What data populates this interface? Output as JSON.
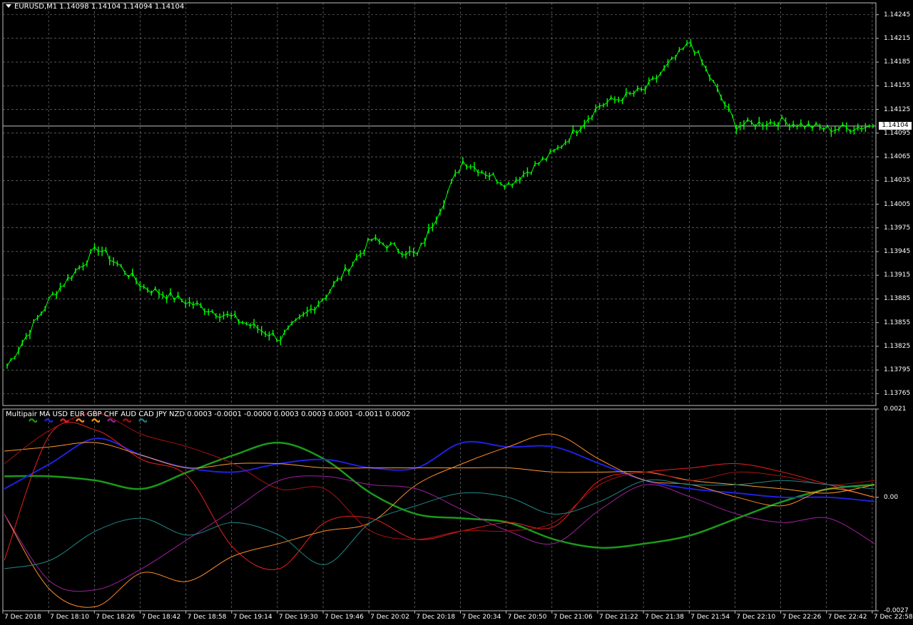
{
  "window": {
    "symbol_header": "EURUSD,M1  1.14098 1.14104 1.14094 1.14104"
  },
  "main_chart": {
    "current_price_label": "1.14104",
    "y_ticks": [
      "1.14245",
      "1.14215",
      "1.14185",
      "1.14155",
      "1.14125",
      "1.14095",
      "1.14065",
      "1.14035",
      "1.14005",
      "1.13975",
      "1.13945",
      "1.13915",
      "1.13885",
      "1.13855",
      "1.13825",
      "1.13795",
      "1.13765"
    ]
  },
  "indicator": {
    "header": "Multipair MA  USD EUR GBP CHF AUD CAD JPY NZD 0.0003 -0.0001 -0.0000 0.0003 0.0003 0.0001 -0.0011 0.0002",
    "y_ticks": [
      "0.0021",
      "0.00",
      "-0.0027"
    ],
    "legend_colors": [
      "#1a9a1a",
      "#2222ee",
      "#ee2222",
      "#ff8c2a",
      "#ff9900",
      "#a020a0",
      "#aa1111",
      "#208080"
    ]
  },
  "x_axis": {
    "labels": [
      "7 Dec 2018",
      "7 Dec 18:10",
      "7 Dec 18:26",
      "7 Dec 18:42",
      "7 Dec 18:58",
      "7 Dec 19:14",
      "7 Dec 19:30",
      "7 Dec 19:46",
      "7 Dec 20:02",
      "7 Dec 20:18",
      "7 Dec 20:34",
      "7 Dec 20:50",
      "7 Dec 21:06",
      "7 Dec 21:22",
      "7 Dec 21:38",
      "7 Dec 21:54",
      "7 Dec 22:10",
      "7 Dec 22:26",
      "7 Dec 22:42",
      "7 Dec 22:58"
    ]
  },
  "chart_data": [
    {
      "type": "line",
      "title": "EURUSD,M1",
      "series": [
        {
          "name": "EURUSD",
          "color": "#00ff00",
          "x": [
            "7 Dec 2018",
            "7 Dec 18:10",
            "7 Dec 18:26",
            "7 Dec 18:42",
            "7 Dec 18:58",
            "7 Dec 19:14",
            "7 Dec 19:30",
            "7 Dec 19:46",
            "7 Dec 20:02",
            "7 Dec 20:18",
            "7 Dec 20:34",
            "7 Dec 20:50",
            "7 Dec 21:06",
            "7 Dec 21:22",
            "7 Dec 21:38",
            "7 Dec 21:54",
            "7 Dec 22:10",
            "7 Dec 22:26",
            "7 Dec 22:42",
            "7 Dec 22:58"
          ],
          "values": [
            1.138,
            1.1389,
            1.1395,
            1.139,
            1.1388,
            1.1386,
            1.13835,
            1.1389,
            1.1396,
            1.1394,
            1.1406,
            1.1403,
            1.1407,
            1.1413,
            1.1415,
            1.1421,
            1.14105,
            1.1411,
            1.141,
            1.14104
          ]
        }
      ],
      "ylim": [
        1.1375,
        1.1426
      ],
      "grid": true
    },
    {
      "type": "line",
      "title": "Multipair MA",
      "x": [
        "7 Dec 2018",
        "7 Dec 18:10",
        "7 Dec 18:26",
        "7 Dec 18:42",
        "7 Dec 18:58",
        "7 Dec 19:14",
        "7 Dec 19:30",
        "7 Dec 19:46",
        "7 Dec 20:02",
        "7 Dec 20:18",
        "7 Dec 20:34",
        "7 Dec 20:50",
        "7 Dec 21:06",
        "7 Dec 21:22",
        "7 Dec 21:38",
        "7 Dec 21:54",
        "7 Dec 22:10",
        "7 Dec 22:26",
        "7 Dec 22:42",
        "7 Dec 22:58"
      ],
      "series": [
        {
          "name": "USD",
          "color": "#1a9a1a",
          "width": 2.5,
          "values": [
            0.0005,
            0.0005,
            0.0004,
            0.0002,
            0.0006,
            0.001,
            0.0013,
            0.0009,
            0.0001,
            -0.0004,
            -0.0005,
            -0.0006,
            -0.001,
            -0.0012,
            -0.0011,
            -0.0009,
            -0.0005,
            -0.0001,
            0.0002,
            0.0003
          ]
        },
        {
          "name": "EUR",
          "color": "#2020e0",
          "width": 2,
          "values": [
            0.0002,
            0.0008,
            0.0014,
            0.001,
            0.0007,
            0.0006,
            0.0008,
            0.0009,
            0.0007,
            0.0007,
            0.0013,
            0.0012,
            0.0012,
            0.0008,
            0.0004,
            0.0002,
            0.0001,
            0.0,
            0.0,
            -0.0001
          ]
        },
        {
          "name": "GBP",
          "color": "#ee2020",
          "width": 1,
          "values": [
            -0.0015,
            0.0015,
            0.0016,
            0.0009,
            0.0005,
            -0.0012,
            -0.0017,
            -0.0006,
            -0.0005,
            -0.001,
            -0.0008,
            -0.0006,
            -0.0007,
            0.0004,
            0.0006,
            0.0007,
            0.0008,
            0.0006,
            0.0003,
            0.0
          ]
        },
        {
          "name": "CHF",
          "color": "#ff8c2a",
          "width": 1,
          "values": [
            -0.0004,
            -0.0022,
            -0.0026,
            -0.0018,
            -0.002,
            -0.0014,
            -0.0011,
            -0.0008,
            -0.0006,
            0.0003,
            0.0008,
            0.0012,
            0.0015,
            0.0009,
            0.0004,
            0.0003,
            0.0,
            -0.0002,
            0.0002,
            0.0
          ]
        },
        {
          "name": "AUD",
          "color": "#ff9a33",
          "width": 1,
          "values": [
            0.0011,
            0.0012,
            0.0013,
            0.001,
            0.0007,
            0.0008,
            0.0008,
            0.0007,
            0.0007,
            0.0007,
            0.0007,
            0.0007,
            0.0006,
            0.0006,
            0.0006,
            0.0004,
            0.0003,
            0.0002,
            0.0001,
            0.0003
          ]
        },
        {
          "name": "CAD",
          "color": "#a020a0",
          "width": 1,
          "values": [
            -0.0004,
            -0.002,
            -0.0022,
            -0.0017,
            -0.001,
            -0.0003,
            0.0004,
            0.0005,
            0.0003,
            0.0002,
            -0.0003,
            -0.0008,
            -0.0011,
            -0.0003,
            0.0003,
            0.0,
            -0.0004,
            -0.0006,
            -0.0005,
            -0.0011
          ]
        },
        {
          "name": "JPY",
          "color": "#aa1111",
          "width": 1,
          "values": [
            0.0008,
            0.0016,
            0.002,
            0.0015,
            0.0012,
            0.0008,
            0.0002,
            0.0002,
            -0.0008,
            -0.001,
            -0.0008,
            -0.0008,
            -0.0006,
            0.0003,
            0.0006,
            0.0004,
            0.0006,
            0.0005,
            0.0003,
            0.0004
          ]
        },
        {
          "name": "NZD",
          "color": "#208888",
          "width": 1,
          "values": [
            -0.0017,
            -0.0015,
            -0.0008,
            -0.0005,
            -0.0009,
            -0.0006,
            -0.0009,
            -0.0016,
            -0.0006,
            -0.0002,
            0.0001,
            0.0,
            -0.0004,
            -0.0001,
            0.0004,
            0.0003,
            0.0003,
            0.0004,
            0.0003,
            0.0002
          ]
        }
      ],
      "ylim": [
        -0.0027,
        0.0021
      ],
      "grid": true
    }
  ]
}
